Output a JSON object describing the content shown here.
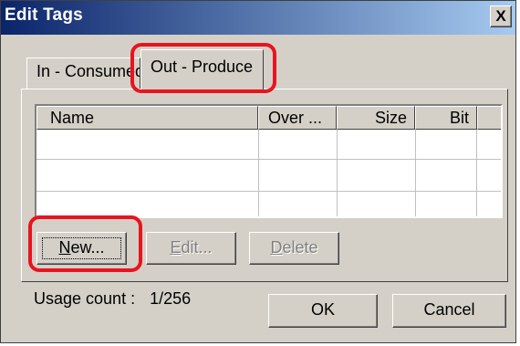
{
  "window": {
    "title": "Edit Tags",
    "close_label": "X"
  },
  "tabs": [
    {
      "label": "In - Consumed",
      "selected": false
    },
    {
      "label": "Out - Produce",
      "selected": true
    }
  ],
  "table": {
    "columns": [
      "Name",
      "Over ...",
      "Size",
      "Bit"
    ],
    "rows": []
  },
  "buttons": {
    "new": {
      "prefix": "",
      "mnemonic": "N",
      "rest": "ew...",
      "enabled": true
    },
    "edit": {
      "prefix": "",
      "mnemonic": "E",
      "rest": "dit...",
      "enabled": false
    },
    "delete": {
      "prefix": "",
      "mnemonic": "D",
      "rest": "elete",
      "enabled": false
    },
    "ok": "OK",
    "cancel": "Cancel"
  },
  "usage": {
    "label": "Usage count :",
    "value": "1/256"
  },
  "colors": {
    "highlight": "#e8141e",
    "titlebar_start": "#0a246a",
    "titlebar_end": "#a6caf0",
    "dialog_bg": "#d4d0c8"
  }
}
